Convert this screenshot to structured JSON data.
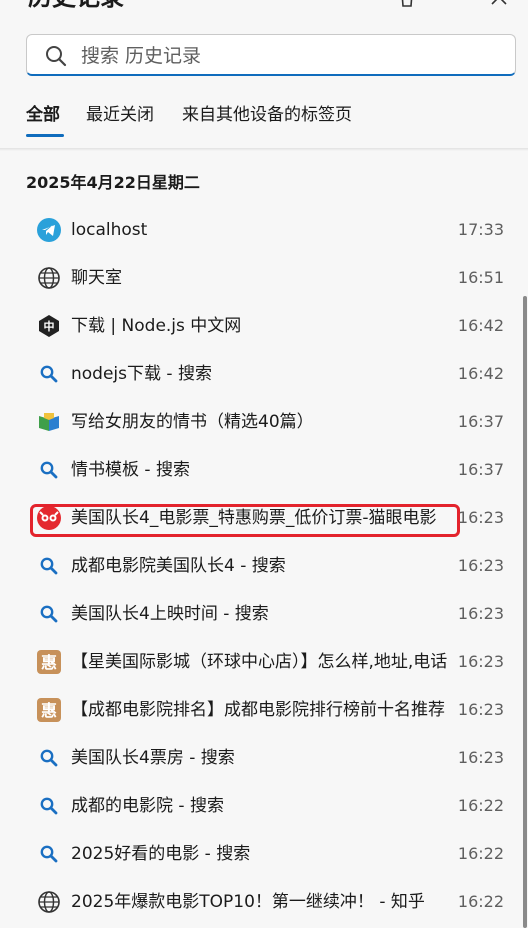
{
  "header": {
    "title": "历史记录",
    "trash_icon": "trash-icon",
    "pin_icon": "pin-icon"
  },
  "search": {
    "placeholder": "搜索 历史记录"
  },
  "tabs": [
    {
      "label": "全部",
      "active": true
    },
    {
      "label": "最近关闭",
      "active": false
    },
    {
      "label": "来自其他设备的标签页",
      "active": false
    }
  ],
  "date_heading": "2025年4月22日星期二",
  "rows": [
    {
      "title": "localhost",
      "time": "17:33",
      "icon": "telegram-icon"
    },
    {
      "title": "聊天室",
      "time": "16:51",
      "icon": "globe-icon"
    },
    {
      "title": "下载 | Node.js 中文网",
      "time": "16:42",
      "icon": "nodejs-icon"
    },
    {
      "title": "nodejs下载 - 搜索",
      "time": "16:42",
      "icon": "search-icon"
    },
    {
      "title": "写给女朋友的情书（精选40篇）",
      "time": "16:37",
      "icon": "book-icon"
    },
    {
      "title": "情书模板 - 搜索",
      "time": "16:37",
      "icon": "search-icon"
    },
    {
      "title": "美国队长4_电影票_特惠购票_低价订票-猫眼电影",
      "time": "16:23",
      "icon": "maoyan-icon",
      "highlighted": true
    },
    {
      "title": "成都电影院美国队长4 - 搜索",
      "time": "16:23",
      "icon": "search-icon"
    },
    {
      "title": "美国队长4上映时间 - 搜索",
      "time": "16:23",
      "icon": "search-icon"
    },
    {
      "title": "【星美国际影城（环球中心店）】怎么样,地址,电话",
      "time": "16:23",
      "icon": "hui-icon"
    },
    {
      "title": "【成都电影院排名】成都电影院排行榜前十名推荐",
      "time": "16:23",
      "icon": "hui-icon"
    },
    {
      "title": "美国队长4票房 - 搜索",
      "time": "16:23",
      "icon": "search-icon"
    },
    {
      "title": "成都的电影院 - 搜索",
      "time": "16:22",
      "icon": "search-icon"
    },
    {
      "title": "2025好看的电影 - 搜索",
      "time": "16:22",
      "icon": "search-icon"
    },
    {
      "title": "2025年爆款电影TOP10！第一继续冲！ - 知乎",
      "time": "16:22",
      "icon": "globe-icon"
    }
  ],
  "hui_glyph": "惠",
  "node_glyph": "中",
  "colors": {
    "accent": "#0f6cbd",
    "highlight_border": "#e3232c",
    "hui_bg": "#c7915a",
    "telegram": "#2aa1da"
  }
}
